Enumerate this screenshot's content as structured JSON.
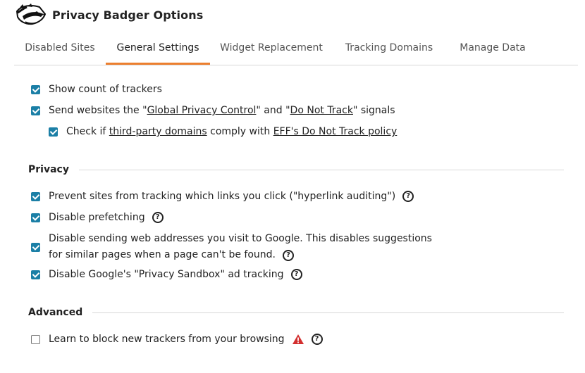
{
  "header": {
    "title": "Privacy Badger Options"
  },
  "tabs": [
    {
      "label": "Disabled Sites"
    },
    {
      "label": "General Settings"
    },
    {
      "label": "Widget Replacement"
    },
    {
      "label": "Tracking Domains"
    },
    {
      "label": "Manage Data"
    }
  ],
  "active_tab": "General Settings",
  "general": {
    "show_count": {
      "label": "Show count of trackers",
      "checked": true
    },
    "send_signals": {
      "checked": true,
      "pre": "Send websites the \"",
      "gpc": "Global Privacy Control",
      "mid": "\" and \"",
      "dnt": "Do Not Track",
      "post": "\" signals"
    },
    "check_dnt": {
      "checked": true,
      "pre": "Check if ",
      "link1": "third-party domains",
      "mid": " comply with ",
      "link2": "EFF's Do Not Track policy"
    }
  },
  "privacy": {
    "title": "Privacy",
    "hyperlink": {
      "label": "Prevent sites from tracking which links you click (\"hyperlink auditing\")",
      "checked": true
    },
    "prefetch": {
      "label": "Disable prefetching",
      "checked": true
    },
    "google_alt": {
      "line1": "Disable sending web addresses you visit to Google. This disables suggestions",
      "line2": "for similar pages when a page can't be found.",
      "checked": true
    },
    "sandbox": {
      "label": "Disable Google's \"Privacy Sandbox\" ad tracking",
      "checked": true
    }
  },
  "advanced": {
    "title": "Advanced",
    "learn": {
      "label": "Learn to block new trackers from your browsing",
      "checked": false
    }
  },
  "help_glyph": "?",
  "icons": {
    "help": "question-circle-icon",
    "warning": "warning-triangle-icon",
    "logo": "badger-logo"
  },
  "colors": {
    "accent": "#ec7f2f",
    "checkbox": "#1b7fa6",
    "warning": "#d32f2f"
  }
}
